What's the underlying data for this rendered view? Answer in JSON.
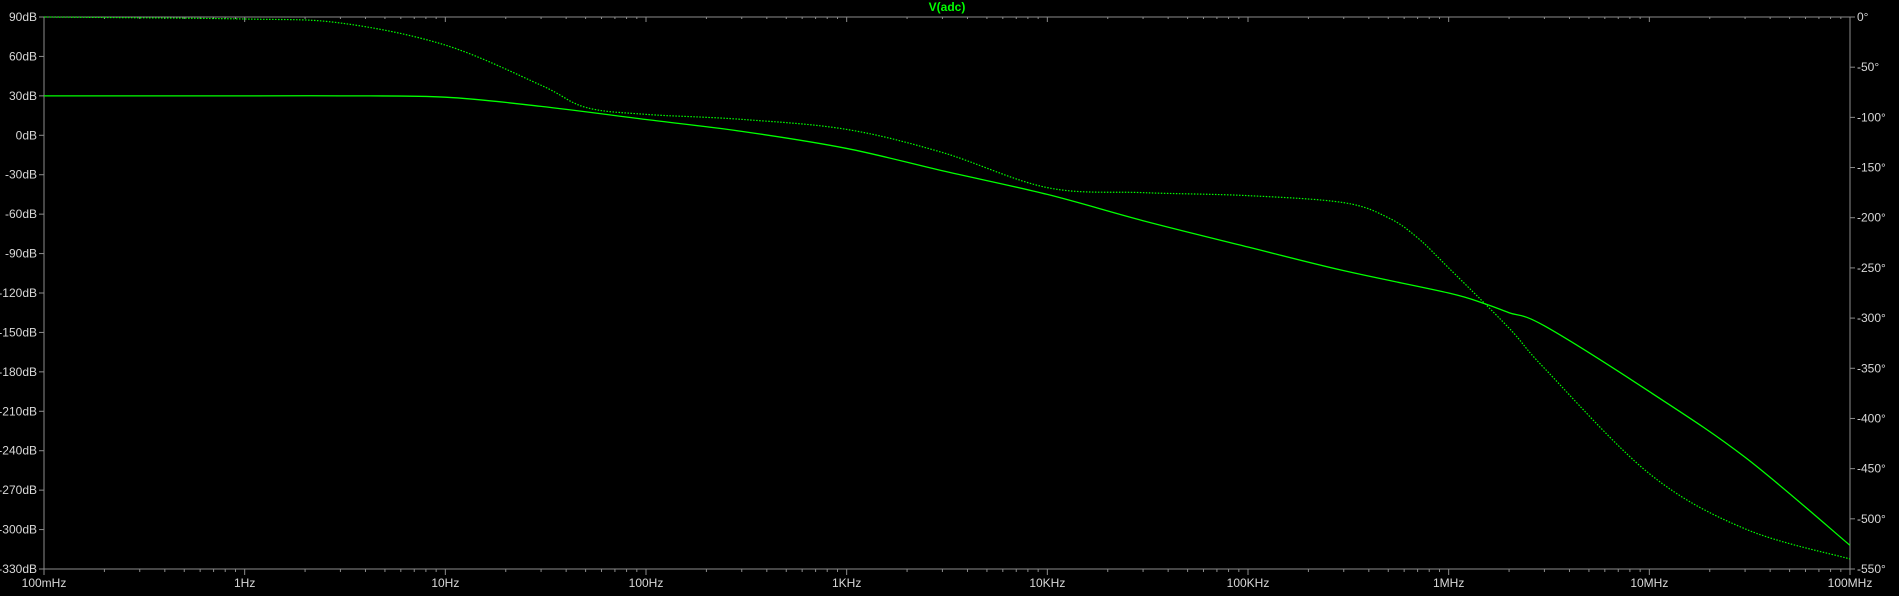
{
  "chart_data": {
    "type": "line",
    "title": "V(adc)",
    "x_scale": "log",
    "xlim": [
      0.1,
      100000000
    ],
    "x_ticks": [
      {
        "value": 0.1,
        "label": "100mHz"
      },
      {
        "value": 1,
        "label": "1Hz"
      },
      {
        "value": 10,
        "label": "10Hz"
      },
      {
        "value": 100,
        "label": "100Hz"
      },
      {
        "value": 1000,
        "label": "1KHz"
      },
      {
        "value": 10000,
        "label": "10KHz"
      },
      {
        "value": 100000,
        "label": "100KHz"
      },
      {
        "value": 1000000,
        "label": "1MHz"
      },
      {
        "value": 10000000,
        "label": "10MHz"
      },
      {
        "value": 100000000,
        "label": "100MHz"
      }
    ],
    "y_left": {
      "ylim": [
        -330,
        90
      ],
      "ticks": [
        {
          "value": 90,
          "label": "90dB"
        },
        {
          "value": 60,
          "label": "60dB"
        },
        {
          "value": 30,
          "label": "30dB"
        },
        {
          "value": 0,
          "label": "0dB"
        },
        {
          "value": -30,
          "label": "-30dB"
        },
        {
          "value": -60,
          "label": "-60dB"
        },
        {
          "value": -90,
          "label": "-90dB"
        },
        {
          "value": -120,
          "label": "-120dB"
        },
        {
          "value": -150,
          "label": "-150dB"
        },
        {
          "value": -180,
          "label": "-180dB"
        },
        {
          "value": -210,
          "label": "-210dB"
        },
        {
          "value": -240,
          "label": "-240dB"
        },
        {
          "value": -270,
          "label": "-270dB"
        },
        {
          "value": -300,
          "label": "-300dB"
        },
        {
          "value": -330,
          "label": "-330dB"
        }
      ]
    },
    "y_right": {
      "ylim": [
        -550,
        0
      ],
      "ticks": [
        {
          "value": 0,
          "label": "0°"
        },
        {
          "value": -50,
          "label": "-50°"
        },
        {
          "value": -100,
          "label": "-100°"
        },
        {
          "value": -150,
          "label": "-150°"
        },
        {
          "value": -200,
          "label": "-200°"
        },
        {
          "value": -250,
          "label": "-250°"
        },
        {
          "value": -300,
          "label": "-300°"
        },
        {
          "value": -350,
          "label": "-350°"
        },
        {
          "value": -400,
          "label": "-400°"
        },
        {
          "value": -450,
          "label": "-450°"
        },
        {
          "value": -500,
          "label": "-500°"
        },
        {
          "value": -550,
          "label": "-550°"
        }
      ]
    },
    "grid": false,
    "colors": {
      "background": "#000000",
      "frame": "#8c8c8c",
      "tick_label": "#d8d8d8",
      "title": "#00ff00",
      "trace": "#00ff00"
    },
    "series": [
      {
        "quantity": "magnitude",
        "axis": "left",
        "style": "solid",
        "x": [
          0.1,
          1,
          3,
          10,
          30,
          100,
          300,
          1000,
          3000,
          10000,
          30000,
          100000,
          300000,
          1000000,
          1500000,
          2000000,
          3000000,
          10000000,
          30000000,
          100000000
        ],
        "y": [
          30,
          30,
          30,
          29,
          22,
          12,
          3,
          -10,
          -27,
          -45,
          -65,
          -85,
          -103,
          -120,
          -128,
          -135,
          -145,
          -195,
          -245,
          -312
        ]
      },
      {
        "quantity": "phase",
        "axis": "right",
        "style": "dotted",
        "x": [
          0.1,
          1,
          3,
          10,
          30,
          50,
          100,
          300,
          1000,
          3000,
          10000,
          30000,
          100000,
          300000,
          500000,
          700000,
          1000000,
          2000000,
          3000000,
          10000000,
          30000000,
          100000000
        ],
        "y": [
          0,
          -2,
          -6,
          -28,
          -68,
          -90,
          -97,
          -102,
          -112,
          -135,
          -170,
          -175,
          -178,
          -185,
          -200,
          -220,
          -250,
          -310,
          -350,
          -455,
          -510,
          -540
        ]
      }
    ]
  }
}
